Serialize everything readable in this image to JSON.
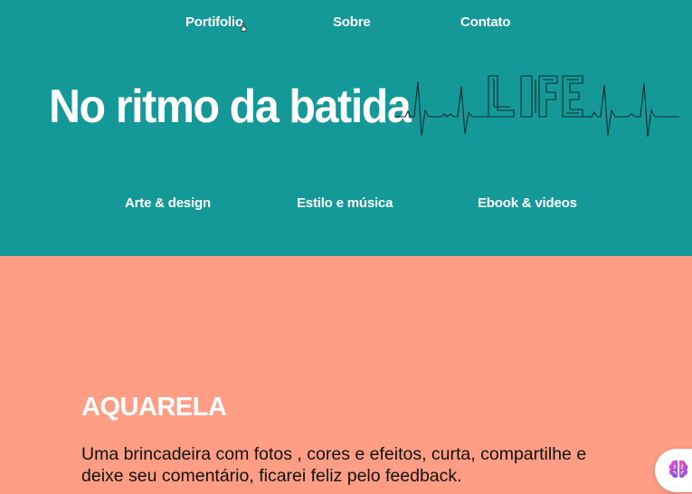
{
  "topnav": {
    "items": [
      {
        "label": "Portifolio"
      },
      {
        "label": "Sobre"
      },
      {
        "label": "Contato"
      }
    ]
  },
  "hero": {
    "title": "No ritmo da batida",
    "ekg_text": "LIFE",
    "background_color": "#149898"
  },
  "subnav": {
    "items": [
      {
        "label": "Arte & design"
      },
      {
        "label": "Estilo e música"
      },
      {
        "label": "Ebook & videos"
      }
    ]
  },
  "section": {
    "title": "AQUARELA",
    "text": "Uma brincadeira com fotos , cores e efeitos, curta, compartilhe e deixe seu comentário, ficarei feliz pelo feedback.",
    "background_color": "#ff9e84"
  },
  "widget": {
    "icon": "brain-icon"
  }
}
